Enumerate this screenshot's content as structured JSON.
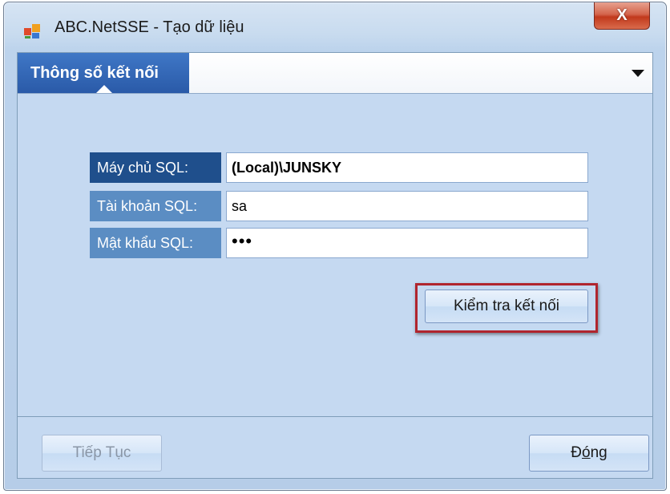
{
  "window": {
    "title": "ABC.NetSSE - Tạo dữ liệu",
    "close_label": "X"
  },
  "tabs": [
    {
      "label": "Thông số kết nối",
      "active": true
    }
  ],
  "form": {
    "server": {
      "label": "Máy chủ SQL:",
      "value": "(Local)\\JUNSKY"
    },
    "account": {
      "label": "Tài khoản SQL:",
      "value": "sa"
    },
    "password": {
      "label": "Mật khẩu SQL:",
      "value": "•••"
    }
  },
  "buttons": {
    "test_connection": "Kiểm tra kết nối",
    "next": "Tiếp Tục",
    "close_prefix": "Đ",
    "close_underlined": "ó",
    "close_suffix": "ng"
  },
  "colors": {
    "tab_active": "#2f63b0",
    "label_dark": "#1f4f8c",
    "label_mid": "#5b8dc3",
    "highlight": "#b0252e",
    "close_button": "#c94a30"
  }
}
